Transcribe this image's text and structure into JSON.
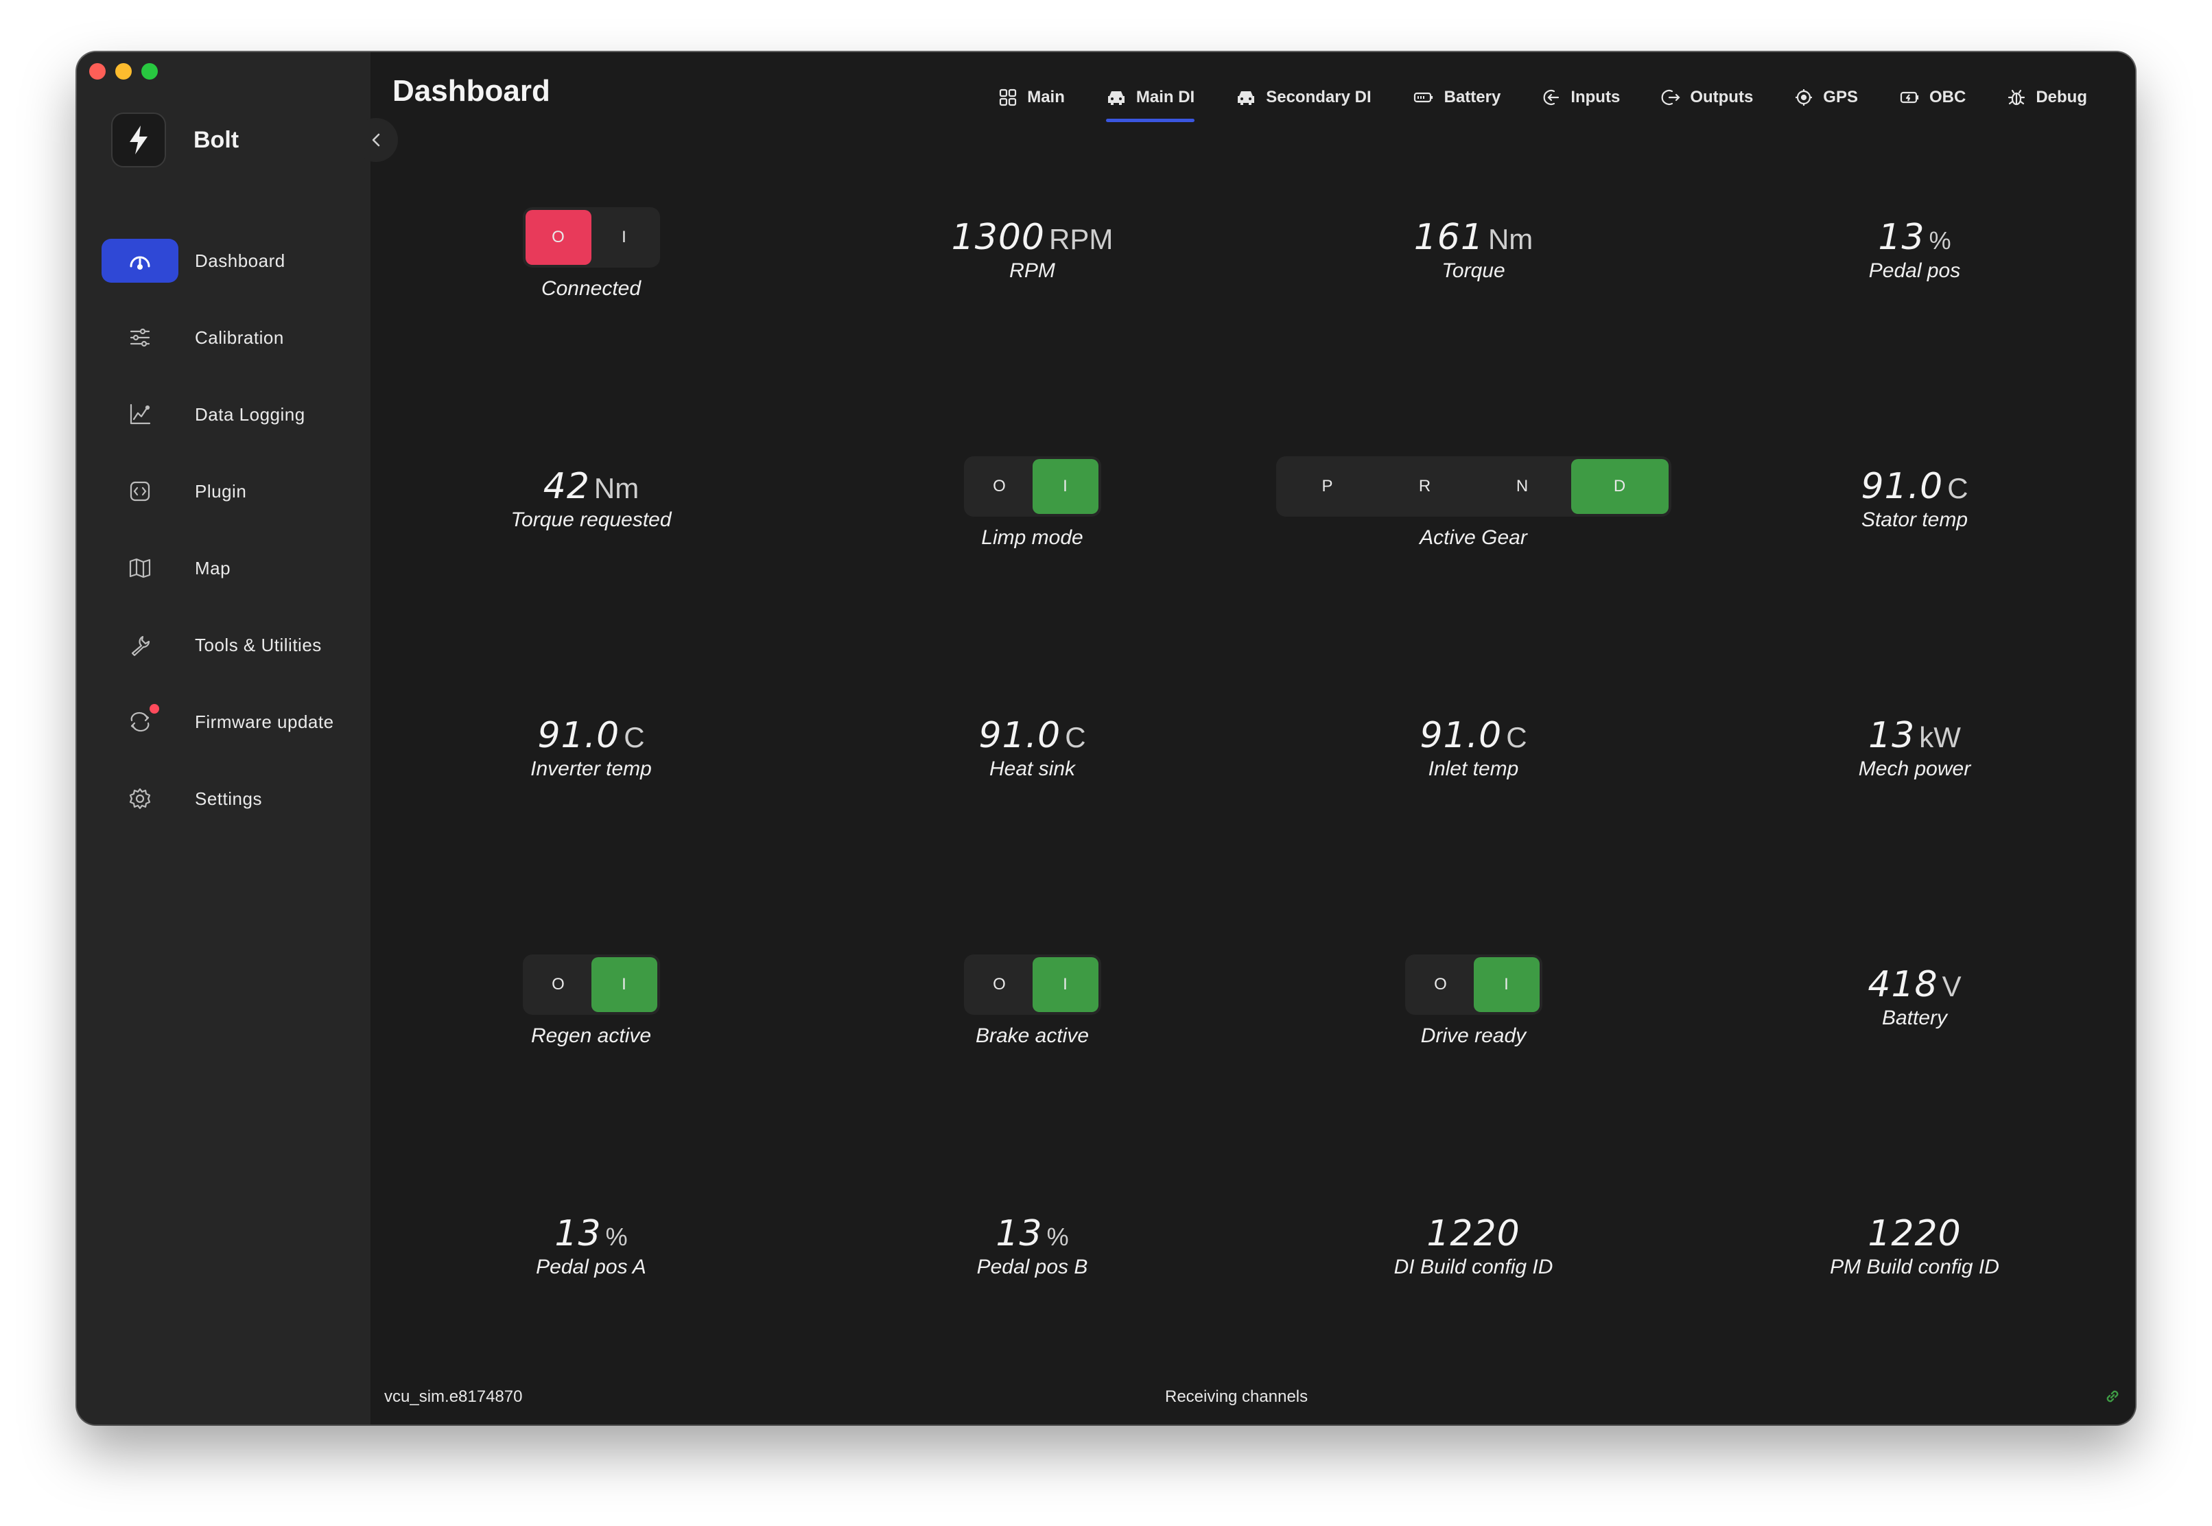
{
  "window": {
    "traffic": [
      "close",
      "minimize",
      "zoom"
    ]
  },
  "sidebar": {
    "brand": "Bolt",
    "brand_icon": "lightning-icon",
    "items": [
      {
        "label": "Dashboard",
        "icon": "gauge-icon",
        "active": true
      },
      {
        "label": "Calibration",
        "icon": "sliders-icon"
      },
      {
        "label": "Data Logging",
        "icon": "chart-line-icon"
      },
      {
        "label": "Plugin",
        "icon": "plugin-icon"
      },
      {
        "label": "Map",
        "icon": "map-icon"
      },
      {
        "label": "Tools & Utilities",
        "icon": "wrench-icon"
      },
      {
        "label": "Firmware update",
        "icon": "refresh-icon",
        "badge": true
      },
      {
        "label": "Settings",
        "icon": "gear-icon"
      }
    ]
  },
  "header": {
    "title": "Dashboard",
    "tabs": [
      {
        "label": "Main",
        "icon": "grid-icon"
      },
      {
        "label": "Main DI",
        "icon": "car-icon",
        "active": true
      },
      {
        "label": "Secondary DI",
        "icon": "car-icon"
      },
      {
        "label": "Battery",
        "icon": "battery-icon"
      },
      {
        "label": "Inputs",
        "icon": "input-icon"
      },
      {
        "label": "Outputs",
        "icon": "output-icon"
      },
      {
        "label": "GPS",
        "icon": "target-icon"
      },
      {
        "label": "OBC",
        "icon": "charger-icon"
      },
      {
        "label": "Debug",
        "icon": "bug-icon"
      }
    ]
  },
  "widgets": {
    "connected": {
      "label": "Connected",
      "off": "O",
      "on": "I",
      "state": "off"
    },
    "rpm": {
      "value": "1300",
      "unit": "RPM",
      "label": "RPM"
    },
    "torque": {
      "value": "161",
      "unit": "Nm",
      "label": "Torque"
    },
    "pedal_pos": {
      "value": "13",
      "unit": "%",
      "label": "Pedal pos"
    },
    "torque_requested": {
      "value": "42",
      "unit": "Nm",
      "label": "Torque requested"
    },
    "limp_mode": {
      "label": "Limp mode",
      "off": "O",
      "on": "I",
      "state": "on"
    },
    "active_gear": {
      "label": "Active Gear",
      "options": [
        "P",
        "R",
        "N",
        "D"
      ],
      "selected": "D"
    },
    "stator_temp": {
      "value": "91.0",
      "unit": "C",
      "label": "Stator temp"
    },
    "inverter_temp": {
      "value": "91.0",
      "unit": "C",
      "label": "Inverter temp"
    },
    "heat_sink": {
      "value": "91.0",
      "unit": "C",
      "label": "Heat sink"
    },
    "inlet_temp": {
      "value": "91.0",
      "unit": "C",
      "label": "Inlet temp"
    },
    "mech_power": {
      "value": "13",
      "unit": "kW",
      "label": "Mech power"
    },
    "regen_active": {
      "label": "Regen active",
      "off": "O",
      "on": "I",
      "state": "on"
    },
    "brake_active": {
      "label": "Brake active",
      "off": "O",
      "on": "I",
      "state": "on"
    },
    "drive_ready": {
      "label": "Drive ready",
      "off": "O",
      "on": "I",
      "state": "on"
    },
    "battery": {
      "value": "418",
      "unit": "V",
      "label": "Battery"
    },
    "pedal_pos_a": {
      "value": "13",
      "unit": "%",
      "label": "Pedal pos A"
    },
    "pedal_pos_b": {
      "value": "13",
      "unit": "%",
      "label": "Pedal pos B"
    },
    "di_build": {
      "value": "1220",
      "label": "DI Build config ID"
    },
    "pm_build": {
      "value": "1220",
      "label": "PM Build config ID"
    }
  },
  "status": {
    "device": "vcu_sim.e8174870",
    "message": "Receiving channels",
    "link_icon": "link-icon",
    "colors": {
      "accent": "#2f48d6",
      "on": "#3e9b44",
      "off_alert": "#e83a5a",
      "link": "#3e9b44"
    }
  }
}
